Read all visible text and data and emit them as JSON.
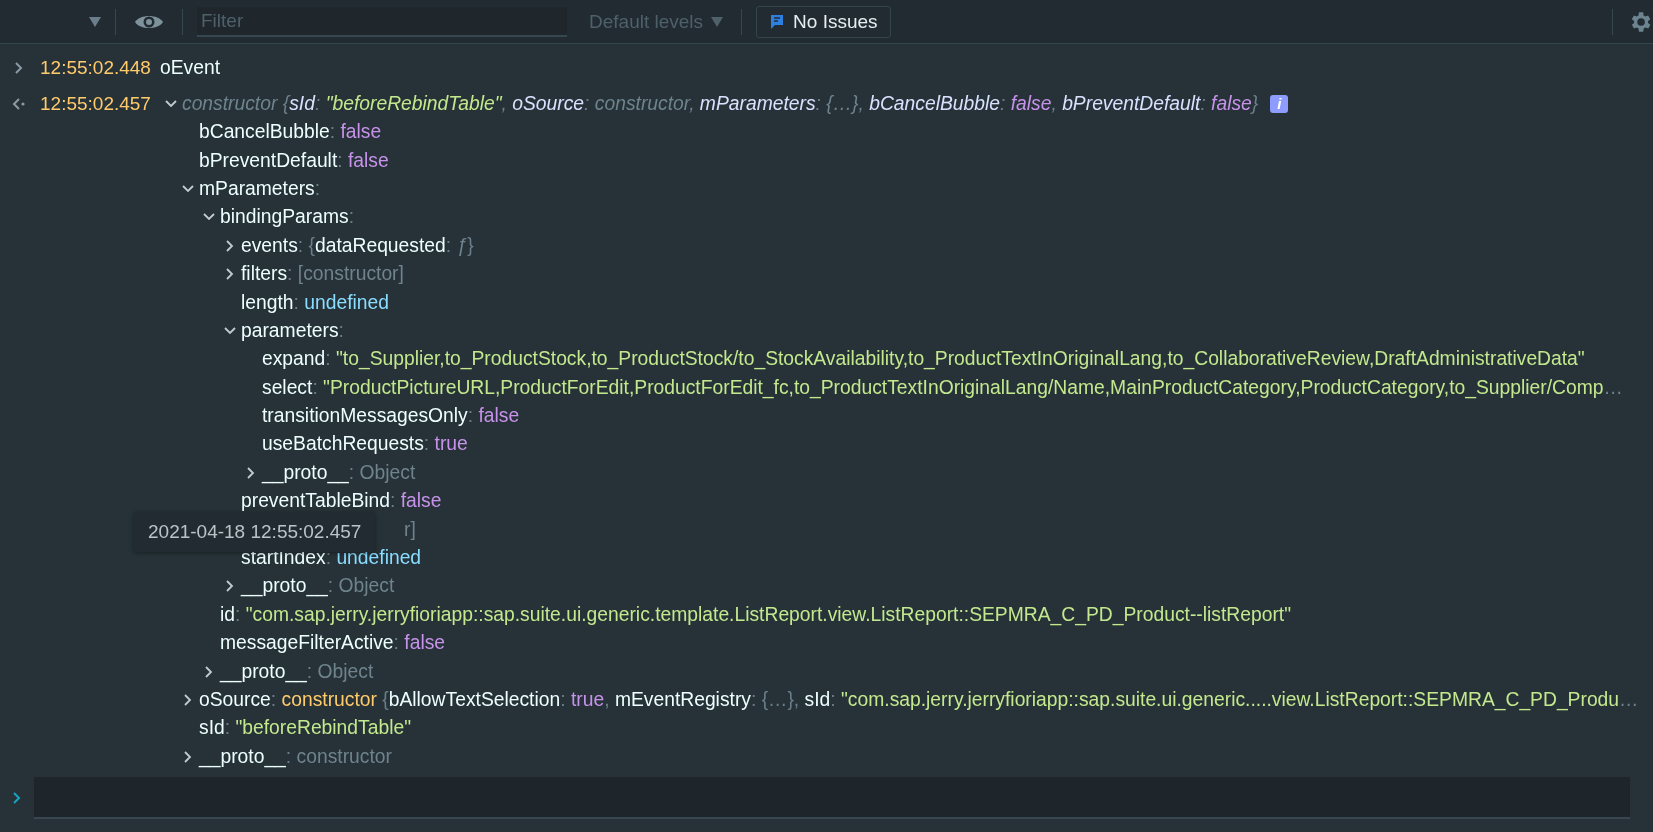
{
  "toolbar": {
    "filter": {
      "placeholder": "Filter"
    },
    "levels": "Default levels",
    "issues": "No Issues"
  },
  "messages": [
    {
      "kind": "input",
      "time": "12:55:02.448",
      "parts": [
        {
          "kind": "key",
          "text": "oEvent"
        }
      ]
    },
    {
      "kind": "result",
      "time": "12:55:02.457",
      "expanded": true,
      "badge": "i",
      "parts": [
        {
          "kind": "muted",
          "text": "constructor"
        },
        {
          "kind": "punct",
          "text": " {"
        },
        {
          "kind": "key",
          "text": "sId"
        },
        {
          "kind": "punct",
          "text": ": "
        },
        {
          "kind": "str",
          "text": "\"beforeRebindTable\""
        },
        {
          "kind": "punct",
          "text": ", "
        },
        {
          "kind": "key",
          "text": "oSource"
        },
        {
          "kind": "punct",
          "text": ": "
        },
        {
          "kind": "muted",
          "text": "constructor"
        },
        {
          "kind": "punct",
          "text": ", "
        },
        {
          "kind": "key",
          "text": "mParameters"
        },
        {
          "kind": "punct",
          "text": ": "
        },
        {
          "kind": "muted",
          "text": "{…}"
        },
        {
          "kind": "punct",
          "text": ", "
        },
        {
          "kind": "key",
          "text": "bCancelBubble"
        },
        {
          "kind": "punct",
          "text": ": "
        },
        {
          "kind": "kw",
          "text": "false"
        },
        {
          "kind": "punct",
          "text": ", "
        },
        {
          "kind": "key",
          "text": "bPreventDefault"
        },
        {
          "kind": "punct",
          "text": ": "
        },
        {
          "kind": "kw",
          "text": "false"
        },
        {
          "kind": "punct",
          "text": "}"
        }
      ],
      "children": [
        {
          "parts": [
            {
              "kind": "key",
              "text": "bCancelBubble"
            },
            {
              "kind": "punct",
              "text": ": "
            },
            {
              "kind": "kw",
              "text": "false"
            }
          ]
        },
        {
          "parts": [
            {
              "kind": "key",
              "text": "bPreventDefault"
            },
            {
              "kind": "punct",
              "text": ": "
            },
            {
              "kind": "kw",
              "text": "false"
            }
          ]
        },
        {
          "expanded": true,
          "parts": [
            {
              "kind": "key",
              "text": "mParameters"
            },
            {
              "kind": "punct",
              "text": ":"
            }
          ],
          "children": [
            {
              "expanded": true,
              "parts": [
                {
                  "kind": "key",
                  "text": "bindingParams"
                },
                {
                  "kind": "punct",
                  "text": ":"
                }
              ],
              "children": [
                {
                  "expanded": false,
                  "parts": [
                    {
                      "kind": "key",
                      "text": "events"
                    },
                    {
                      "kind": "punct",
                      "text": ": {"
                    },
                    {
                      "kind": "key",
                      "text": "dataRequested"
                    },
                    {
                      "kind": "punct",
                      "text": ": "
                    },
                    {
                      "kind": "fn",
                      "text": "ƒ"
                    },
                    {
                      "kind": "punct",
                      "text": "}"
                    }
                  ]
                },
                {
                  "expanded": false,
                  "parts": [
                    {
                      "kind": "key",
                      "text": "filters"
                    },
                    {
                      "kind": "punct",
                      "text": ": "
                    },
                    {
                      "kind": "muted",
                      "text": "[constructor]"
                    }
                  ]
                },
                {
                  "parts": [
                    {
                      "kind": "key",
                      "text": "length"
                    },
                    {
                      "kind": "punct",
                      "text": ": "
                    },
                    {
                      "kind": "undef",
                      "text": "undefined"
                    }
                  ]
                },
                {
                  "expanded": true,
                  "parts": [
                    {
                      "kind": "key",
                      "text": "parameters"
                    },
                    {
                      "kind": "punct",
                      "text": ":"
                    }
                  ],
                  "children": [
                    {
                      "parts": [
                        {
                          "kind": "key",
                          "text": "expand"
                        },
                        {
                          "kind": "punct",
                          "text": ": "
                        },
                        {
                          "kind": "str",
                          "text": "\"to_Supplier,to_ProductStock,to_ProductStock/to_StockAvailability,to_ProductTextInOriginalLang,to_CollaborativeReview,DraftAdministrativeData\""
                        }
                      ]
                    },
                    {
                      "parts": [
                        {
                          "kind": "key",
                          "text": "select"
                        },
                        {
                          "kind": "punct",
                          "text": ": "
                        },
                        {
                          "kind": "str",
                          "text": "\"ProductPictureURL,ProductForEdit,ProductForEdit_fc,to_ProductTextInOriginalLang/Name,MainProductCategory,ProductCategory,to_Supplier/Comp"
                        },
                        {
                          "kind": "muted",
                          "text": "…"
                        }
                      ]
                    },
                    {
                      "parts": [
                        {
                          "kind": "key",
                          "text": "transitionMessagesOnly"
                        },
                        {
                          "kind": "punct",
                          "text": ": "
                        },
                        {
                          "kind": "kw",
                          "text": "false"
                        }
                      ]
                    },
                    {
                      "parts": [
                        {
                          "kind": "key",
                          "text": "useBatchRequests"
                        },
                        {
                          "kind": "punct",
                          "text": ": "
                        },
                        {
                          "kind": "kw",
                          "text": "true"
                        }
                      ]
                    },
                    {
                      "expanded": false,
                      "parts": [
                        {
                          "kind": "key",
                          "text": "__proto__"
                        },
                        {
                          "kind": "punct",
                          "text": ": "
                        },
                        {
                          "kind": "muted",
                          "text": "Object"
                        }
                      ]
                    }
                  ]
                },
                {
                  "parts": [
                    {
                      "kind": "key",
                      "text": "preventTableBind"
                    },
                    {
                      "kind": "punct",
                      "text": ": "
                    },
                    {
                      "kind": "kw",
                      "text": "false"
                    }
                  ]
                },
                {
                  "kind": "covered",
                  "parts": [
                    {
                      "kind": "muted",
                      "text": "r]"
                    }
                  ]
                },
                {
                  "parts": [
                    {
                      "kind": "key",
                      "text": "startIndex"
                    },
                    {
                      "kind": "punct",
                      "text": ": "
                    },
                    {
                      "kind": "undef",
                      "text": "undefined"
                    }
                  ]
                },
                {
                  "expanded": false,
                  "parts": [
                    {
                      "kind": "key",
                      "text": "__proto__"
                    },
                    {
                      "kind": "punct",
                      "text": ": "
                    },
                    {
                      "kind": "muted",
                      "text": "Object"
                    }
                  ]
                }
              ]
            },
            {
              "parts": [
                {
                  "kind": "key",
                  "text": "id"
                },
                {
                  "kind": "punct",
                  "text": ": "
                },
                {
                  "kind": "str",
                  "text": "\"com.sap.jerry.jerryfioriapp::sap.suite.ui.generic.template.ListReport.view.ListReport::SEPMRA_C_PD_Product--listReport\""
                }
              ]
            },
            {
              "parts": [
                {
                  "kind": "key",
                  "text": "messageFilterActive"
                },
                {
                  "kind": "punct",
                  "text": ": "
                },
                {
                  "kind": "kw",
                  "text": "false"
                }
              ]
            },
            {
              "expanded": false,
              "parts": [
                {
                  "kind": "key",
                  "text": "__proto__"
                },
                {
                  "kind": "punct",
                  "text": ": "
                },
                {
                  "kind": "muted",
                  "text": "Object"
                }
              ]
            }
          ]
        },
        {
          "expanded": false,
          "parts": [
            {
              "kind": "key",
              "text": "oSource"
            },
            {
              "kind": "punct",
              "text": ": "
            },
            {
              "kind": "cls",
              "text": "constructor"
            },
            {
              "kind": "punct",
              "text": " {"
            },
            {
              "kind": "key",
              "text": "bAllowTextSelection"
            },
            {
              "kind": "punct",
              "text": ": "
            },
            {
              "kind": "kw",
              "text": "true"
            },
            {
              "kind": "punct",
              "text": ", "
            },
            {
              "kind": "key",
              "text": "mEventRegistry"
            },
            {
              "kind": "punct",
              "text": ": {…}, "
            },
            {
              "kind": "key",
              "text": "sId"
            },
            {
              "kind": "punct",
              "text": ": "
            },
            {
              "kind": "str",
              "text": "\"com.sap.jerry.jerryfioriapp::sap.suite.ui.generic.....view.ListReport::SEPMRA_C_PD_Produ"
            },
            {
              "kind": "muted",
              "text": "…"
            }
          ]
        },
        {
          "parts": [
            {
              "kind": "key",
              "text": "sId"
            },
            {
              "kind": "punct",
              "text": ": "
            },
            {
              "kind": "str",
              "text": "\"beforeRebindTable\""
            }
          ]
        },
        {
          "expanded": false,
          "parts": [
            {
              "kind": "key",
              "text": "__proto__"
            },
            {
              "kind": "punct",
              "text": ": "
            },
            {
              "kind": "muted",
              "text": "constructor"
            }
          ]
        }
      ]
    }
  ],
  "tooltip": "2021-04-18 12:55:02.457"
}
